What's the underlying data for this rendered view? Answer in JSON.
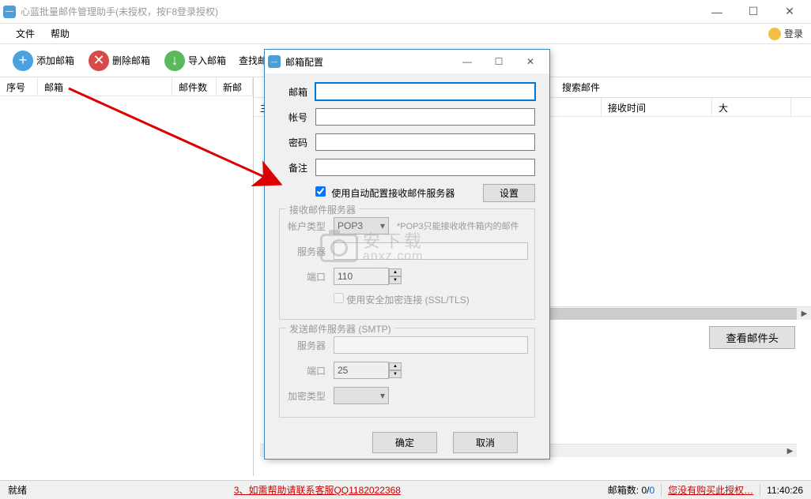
{
  "window": {
    "title": "心蓝批量邮件管理助手(未授权，按F8登录授权)"
  },
  "menu": {
    "file": "文件",
    "help": "帮助",
    "login": "登录"
  },
  "toolbar": {
    "add": "添加邮箱",
    "delete": "删除邮箱",
    "import": "导入邮箱",
    "search": "查找邮"
  },
  "left_table": {
    "cols": {
      "seq": "序号",
      "mailbox": "邮箱",
      "count": "邮件数",
      "new": "新邮"
    }
  },
  "right_top": {
    "search_mail": "搜索邮件"
  },
  "right_table": {
    "cols": {
      "subject": "主题",
      "received": "接收时间",
      "size": "大"
    }
  },
  "right_panel": {
    "view_header": "查看邮件头"
  },
  "statusbar": {
    "ready": "就绪",
    "help_msg": "3、如需帮助请联系客服QQ1182022368",
    "mailbox_count_label": "邮箱数:",
    "mailbox_count": "0",
    "mailbox_sel": "0",
    "no_auth": "您没有购买此授权…",
    "time": "11:40:26"
  },
  "dialog": {
    "title": "邮箱配置",
    "labels": {
      "mailbox": "邮箱",
      "account": "帐号",
      "password": "密码",
      "remark": "备注",
      "auto_cfg": "使用自动配置接收邮件服务器",
      "settings_btn": "设置",
      "recv_server_legend": "接收邮件服务器",
      "acct_type": "帐户类型",
      "acct_type_val": "POP3",
      "pop3_hint": "*POP3只能接收收件箱内的邮件",
      "server": "服务器",
      "port": "端口",
      "recv_port": "110",
      "ssl": "使用安全加密连接 (SSL/TLS)",
      "send_legend": "发送邮件服务器 (SMTP)",
      "send_port": "25",
      "encrypt": "加密类型"
    },
    "buttons": {
      "ok": "确定",
      "cancel": "取消"
    }
  },
  "watermark": {
    "zh": "安下载",
    "en": "anxz.com"
  }
}
